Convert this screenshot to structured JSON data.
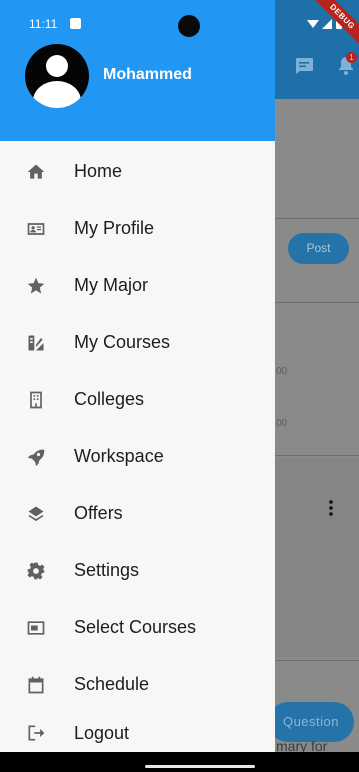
{
  "status_bar": {
    "time": "11:11",
    "debug_banner": "DEBUG"
  },
  "background": {
    "badge_count": "1",
    "post_button": "Post",
    "num_1": "00",
    "num_2": "00",
    "question_button": "Question",
    "snippet": "mary for"
  },
  "drawer": {
    "user_name": "Mohammed",
    "accent_color": "#2196f3",
    "items": [
      {
        "label": "Home",
        "icon": "home-icon"
      },
      {
        "label": "My Profile",
        "icon": "profile-card-icon"
      },
      {
        "label": "My Major",
        "icon": "star-icon"
      },
      {
        "label": "My Courses",
        "icon": "courses-icon"
      },
      {
        "label": "Colleges",
        "icon": "building-icon"
      },
      {
        "label": "Workspace",
        "icon": "rocket-icon"
      },
      {
        "label": "Offers",
        "icon": "layers-icon"
      },
      {
        "label": "Settings",
        "icon": "gear-icon"
      },
      {
        "label": "Select Courses",
        "icon": "picture-in-picture-icon"
      },
      {
        "label": "Schedule",
        "icon": "calendar-icon"
      },
      {
        "label": "Logout",
        "icon": "logout-icon"
      }
    ]
  }
}
